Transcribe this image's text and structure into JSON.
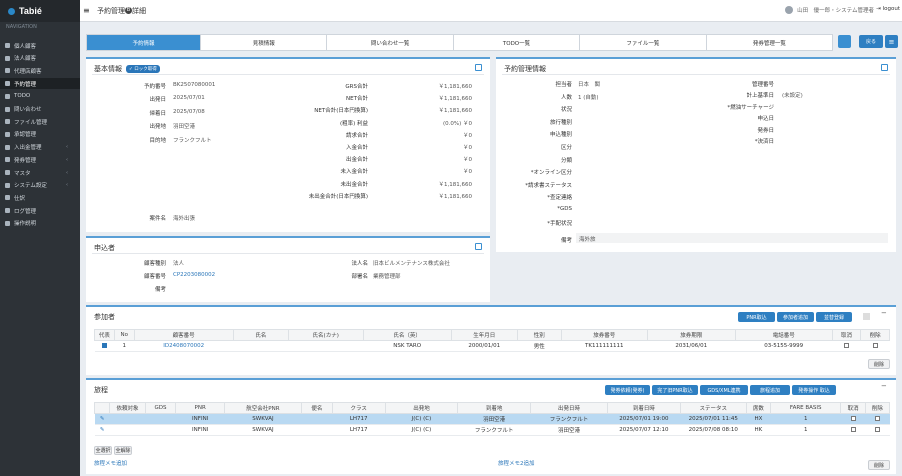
{
  "app": {
    "logo": "Tabié",
    "page_title": "予約管理",
    "page_title_badge": "B",
    "page_title_suffix": "詳細",
    "user": "山田　優一郎・システム管理者",
    "logout": "logout"
  },
  "sidebar": {
    "heading": "NAVIGATION",
    "items": [
      {
        "label": "個人顧客",
        "icon": "person-icon",
        "chev": ""
      },
      {
        "label": "法人顧客",
        "icon": "building-icon",
        "chev": ""
      },
      {
        "label": "代理店顧客",
        "icon": "agency-icon",
        "chev": ""
      },
      {
        "label": "予約管理",
        "icon": "booking-icon",
        "chev": "",
        "active": true
      },
      {
        "label": "TODO",
        "icon": "todo-icon",
        "chev": ""
      },
      {
        "label": "問い合わせ",
        "icon": "inquiry-icon",
        "chev": ""
      },
      {
        "label": "ファイル管理",
        "icon": "file-icon",
        "chev": ""
      },
      {
        "label": "承認管理",
        "icon": "approval-icon",
        "chev": ""
      },
      {
        "label": "入出金管理",
        "icon": "payment-icon",
        "chev": "‹"
      },
      {
        "label": "発券管理",
        "icon": "ticket-icon",
        "chev": "‹"
      },
      {
        "label": "マスタ",
        "icon": "master-icon",
        "chev": "‹"
      },
      {
        "label": "システム設定",
        "icon": "settings-icon",
        "chev": "‹"
      },
      {
        "label": "仕訳",
        "icon": "journal-icon",
        "chev": ""
      },
      {
        "label": "ログ管理",
        "icon": "log-icon",
        "chev": ""
      },
      {
        "label": "操作説明",
        "icon": "help-icon",
        "chev": ""
      }
    ]
  },
  "tabs": [
    "予約情報",
    "見積情報",
    "問い合わせ一覧",
    "TODO一覧",
    "ファイル一覧",
    "発券管理一覧"
  ],
  "actions": {
    "back": "戻る"
  },
  "basic": {
    "title": "基本情報",
    "lock": "ロック取得",
    "left": [
      [
        "予約番号",
        "BK2507080001"
      ],
      [
        "出発日",
        "2025/07/01"
      ],
      [
        "帰着日",
        "2025/07/08"
      ],
      [
        "出発地",
        "羽田空港"
      ],
      [
        "目的地",
        "フランクフルト"
      ]
    ],
    "mid": [
      [
        "GRS合計",
        "￥1,181,660"
      ],
      [
        "NET合計",
        "￥1,181,660"
      ],
      [
        "NET合計(日本円換算)",
        "￥1,181,660"
      ],
      [
        "(粗率) 利益",
        "(0.0%) ￥0"
      ],
      [
        "請求合計",
        "￥0"
      ],
      [
        "入金合計",
        "￥0"
      ],
      [
        "出金合計",
        "￥0"
      ],
      [
        "未入金合計",
        "￥0"
      ],
      [
        "未出金合計",
        "￥1,181,660"
      ],
      [
        "未出金合計(日本円換算)",
        "￥1,181,660"
      ]
    ],
    "case_label": "案件名",
    "case_value": "海外出張"
  },
  "mgmt": {
    "title": "予約管理情報",
    "left": [
      [
        "担当者",
        "日本　閣"
      ],
      [
        "人数",
        "1 (自動)"
      ],
      [
        "状況",
        ""
      ],
      [
        "旅行種別",
        ""
      ],
      [
        "申込種別",
        ""
      ],
      [
        "区分",
        ""
      ],
      [
        "分類",
        ""
      ],
      [
        "*オンライン区分",
        ""
      ],
      [
        "*請求書ステータス",
        ""
      ],
      [
        "*查定連絡",
        ""
      ],
      [
        "*GDS",
        ""
      ],
      [
        "*手配状況",
        ""
      ]
    ],
    "right": [
      [
        "管理番号",
        ""
      ],
      [
        "計上基準日",
        "(未設定)"
      ],
      [
        "*燃油サーチャージ",
        ""
      ],
      [
        "申込日",
        ""
      ],
      [
        "発券日",
        ""
      ],
      [
        "*決済日",
        ""
      ]
    ],
    "remark_label": "備考",
    "remark_value": "海外旅"
  },
  "applicant": {
    "title": "申込者",
    "rows": [
      [
        "顧客種別",
        "法人"
      ],
      [
        "顧客番号",
        "CP2203080002"
      ],
      [
        "備考",
        ""
      ]
    ],
    "rows2": [
      [
        "法人名",
        "旧本ビルメンテナンス株式会社"
      ],
      [
        "部署名",
        "業務管理部"
      ]
    ]
  },
  "participants": {
    "title": "参加者",
    "buttons": [
      "PNR取込",
      "参加者追加",
      "並替登録"
    ],
    "headers": [
      "代表",
      "No",
      "顧客番号",
      "氏名",
      "氏名(カナ)",
      "氏名（英）",
      "生年月日",
      "性別",
      "旅券番号",
      "旅券期限",
      "電話番号",
      "取消",
      "削除"
    ],
    "rows": [
      [
        "",
        "1",
        "ID2408070002",
        "",
        "",
        "NSK TARO",
        "2000/01/01",
        "男性",
        "TK111111111",
        "2031/06/01",
        "03-5155-9999",
        "",
        ""
      ]
    ],
    "delete": "削除"
  },
  "itinerary": {
    "title": "旅程",
    "buttons": [
      "発券依頼(発券)",
      "完了旧PNR取込",
      "GDS/XML連携",
      "旅程追加",
      "発券操作 取込"
    ],
    "headers": [
      "",
      "依頼対象",
      "GDS",
      "PNR",
      "航空会社PNR",
      "便名",
      "クラス",
      "出発地",
      "到着地",
      "出発日時",
      "到着日時",
      "ステータス",
      "席数",
      "FARE BASIS",
      "取消",
      "削除"
    ],
    "rows": [
      [
        "",
        "",
        "INFINI",
        "SWKVAJ",
        "",
        "LH717",
        "J(C) (C)",
        "羽田空港",
        "フランクフルト",
        "2025/07/01 19:00",
        "2025/07/01 11:45",
        "HX",
        "1",
        "",
        ""
      ],
      [
        "",
        "",
        "INFINI",
        "SWKVAJ",
        "",
        "LH717",
        "J(C) (C)",
        "フランクフルト",
        "羽田空港",
        "2025/07/07 12:10",
        "2025/07/08 08:10",
        "HK",
        "1",
        "",
        ""
      ]
    ],
    "select_all": "全選択",
    "deselect_all": "全解除",
    "footer_left": "旅程メモ追加",
    "footer_mid": "旅程メモ2追加",
    "delete": "削除"
  }
}
